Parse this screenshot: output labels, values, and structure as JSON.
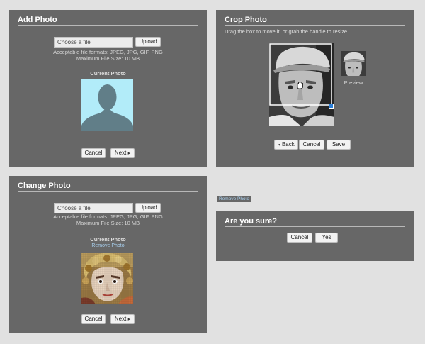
{
  "add_photo": {
    "title": "Add Photo",
    "file_placeholder": "Choose a file",
    "upload_label": "Upload",
    "formats_text": "Acceptable file formats: JPEG, JPG, GIF, PNG",
    "max_size_text": "Maximum File Size: 10 MB",
    "current_photo_label": "Current Photo",
    "cancel_label": "Cancel",
    "next_label": "Next",
    "next_icon": "chevron-right-icon",
    "placeholder_bg": "#b2ecf9",
    "silhouette_color": "#617e88"
  },
  "crop_photo": {
    "title": "Crop Photo",
    "instructions": "Drag the box to move it, or grab the handle to resize.",
    "preview_label": "Preview",
    "back_label": "Back",
    "back_icon": "chevron-left-icon",
    "cancel_label": "Cancel",
    "save_label": "Save",
    "handle_color": "#2b7fd8",
    "cursor_icon": "grab-hand-icon"
  },
  "change_photo": {
    "title": "Change Photo",
    "file_placeholder": "Choose a file",
    "upload_label": "Upload",
    "formats_text": "Acceptable file formats: JPEG, JPG, GIF, PNG",
    "max_size_text": "Maximum File Size: 10 MB",
    "current_photo_label": "Current Photo",
    "remove_photo_label": "Remove Photo",
    "cancel_label": "Cancel",
    "next_label": "Next",
    "next_icon": "chevron-right-icon"
  },
  "remove_photo_tag": {
    "label": "Remove Photo"
  },
  "confirm": {
    "title": "Are you sure?",
    "cancel_label": "Cancel",
    "yes_label": "Yes"
  }
}
